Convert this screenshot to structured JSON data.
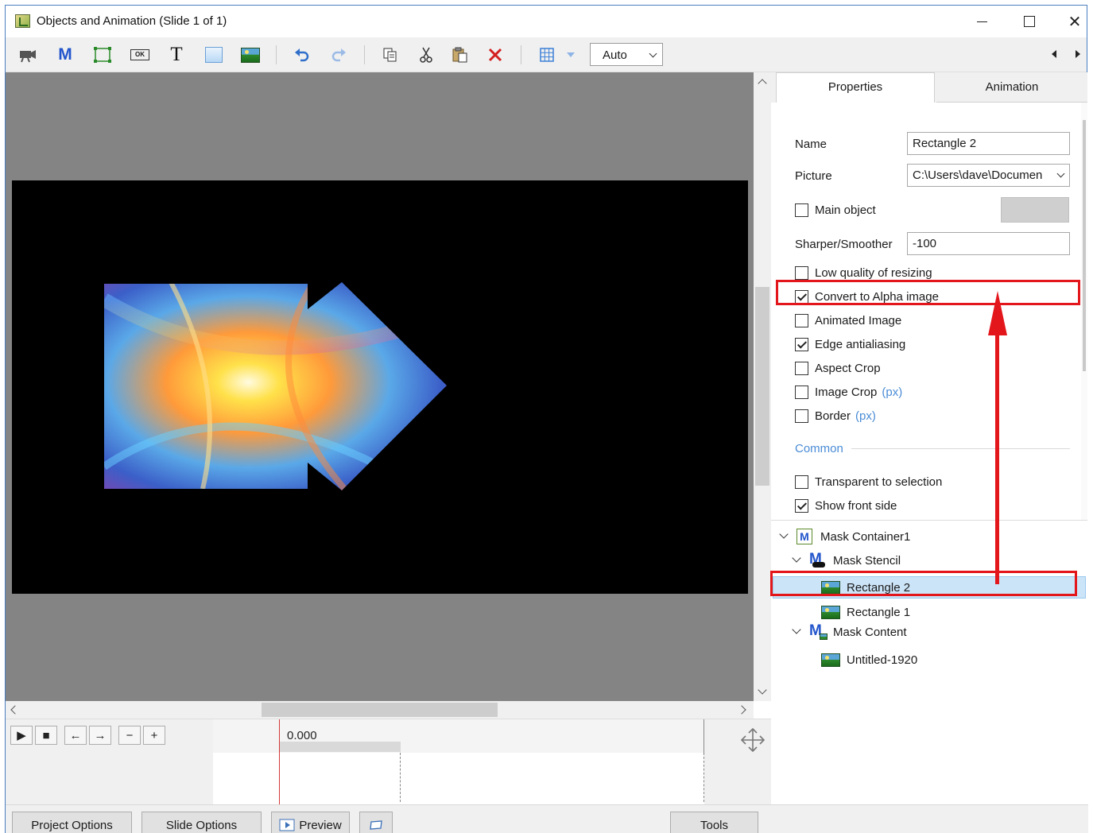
{
  "window": {
    "title": "Objects and Animation (Slide 1 of 1)",
    "controls": {
      "minimize": "minimize-icon",
      "maximize": "maximize-icon",
      "close": "✕"
    }
  },
  "toolbar": {
    "icons": [
      "camera-icon",
      "mask-container-icon",
      "frame-icon",
      "button-icon",
      "text-icon",
      "rectangle-icon",
      "image-icon",
      "undo-icon",
      "redo-icon",
      "copy-icon",
      "cut-icon",
      "paste-icon",
      "delete-icon",
      "grid-icon"
    ],
    "text_label": "T",
    "mask_label": "M",
    "button_label": "OK",
    "zoom_value": "Auto"
  },
  "timeline": {
    "time": "0.000",
    "buttons": [
      "▶",
      "■",
      "←",
      "→",
      "−",
      "+"
    ]
  },
  "tabs": [
    {
      "label": "Properties",
      "active": true
    },
    {
      "label": "Animation",
      "active": false
    }
  ],
  "properties": {
    "name_label": "Name",
    "name_value": "Rectangle 2",
    "picture_label": "Picture",
    "picture_value": "C:\\Users\\dave\\Documen",
    "main_object": {
      "label": "Main object",
      "checked": false
    },
    "sharper_label": "Sharper/Smoother",
    "sharper_value": "-100",
    "checkboxes": [
      {
        "label": "Low quality of resizing",
        "checked": false
      },
      {
        "label": "Convert to Alpha image",
        "checked": true
      },
      {
        "label": "Animated Image",
        "checked": false
      },
      {
        "label": "Edge antialiasing",
        "checked": true
      },
      {
        "label": "Aspect Crop",
        "checked": false
      },
      {
        "label": "Image Crop",
        "checked": false,
        "unit": "(px)"
      },
      {
        "label": "Border",
        "checked": false,
        "unit": "(px)"
      }
    ],
    "common_section": "Common",
    "common_checkboxes": [
      {
        "label": "Transparent to selection",
        "checked": false
      },
      {
        "label": "Show front side",
        "checked": true
      }
    ]
  },
  "tree": {
    "nodes": [
      {
        "label": "Mask Container1",
        "icon": "mask-container-icon",
        "expanded": true
      },
      {
        "label": "Mask Stencil",
        "icon": "mask-stencil-icon",
        "expanded": true
      },
      {
        "label": "Rectangle 2",
        "icon": "image-icon",
        "selected": true
      },
      {
        "label": "Rectangle 1",
        "icon": "image-icon"
      },
      {
        "label": "Mask Content",
        "icon": "mask-content-icon",
        "expanded": true
      },
      {
        "label": "Untitled-1920",
        "icon": "image-icon"
      }
    ]
  },
  "bottom_bar": {
    "project_options": "Project Options",
    "slide_options": "Slide Options",
    "preview": "Preview",
    "tools": "Tools"
  },
  "annotations": {
    "highlight_color": "#e3161b"
  }
}
